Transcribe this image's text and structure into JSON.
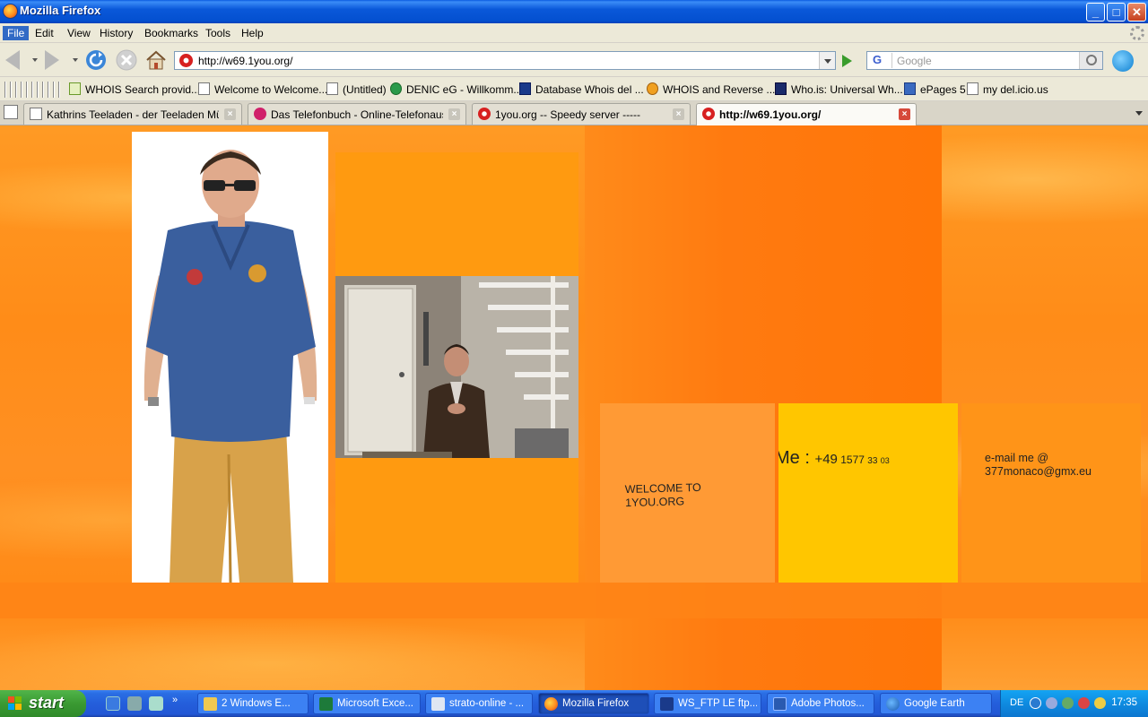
{
  "window": {
    "title": "Mozilla Firefox",
    "controls": {
      "minimize": "_",
      "maximize": "□",
      "close": "✕"
    }
  },
  "menu": [
    {
      "label": "File",
      "active": true
    },
    {
      "label": "Edit"
    },
    {
      "label": "View"
    },
    {
      "label": "History"
    },
    {
      "label": "Bookmarks"
    },
    {
      "label": "Tools"
    },
    {
      "label": "Help"
    }
  ],
  "navigation": {
    "url": "http://w69.1you.org/",
    "search_placeholder": "Google",
    "search_engine_glyph": "G"
  },
  "bookmarks": [
    {
      "label": "WHOIS Search provid...",
      "icon": "n-icon"
    },
    {
      "label": "Welcome to Welcome...",
      "icon": "page-icon"
    },
    {
      "label": "(Untitled)",
      "icon": "page-icon"
    },
    {
      "label": "DENIC eG - Willkomm...",
      "icon": "denic-icon"
    },
    {
      "label": "Database Whois del ...",
      "icon": "database-icon"
    },
    {
      "label": "WHOIS and Reverse ...",
      "icon": "whois-icon"
    },
    {
      "label": "Who.is: Universal Wh...",
      "icon": "whois-square-icon"
    },
    {
      "label": "ePages 5",
      "icon": "epages-icon"
    },
    {
      "label": "my del.icio.us",
      "icon": "page-icon"
    }
  ],
  "tabs": [
    {
      "label": "Kathrins Teeladen - der Teeladen Mün...",
      "active": false,
      "icon": "page-icon"
    },
    {
      "label": "Das Telefonbuch - Online-Telefonausk...",
      "active": false,
      "icon": "telefonbuch-icon"
    },
    {
      "label": "1you.org -- Speedy server -----",
      "active": false,
      "icon": "gear-red-icon"
    },
    {
      "label": "http://w69.1you.org/",
      "active": true,
      "icon": "gear-red-icon"
    }
  ],
  "page": {
    "welcome_line1": "Welcome to",
    "welcome_line2": "1YOU.ORG",
    "phone_prefix": "Me : ",
    "phone_country": "+49",
    "phone_number": "1577",
    "phone_part2": "33",
    "phone_part3": "03",
    "email_label": "e-mail me @",
    "email_address": "377monaco@gmx.eu",
    "colors": {
      "background": "#ff8c18",
      "welcome_tile": "#ff9a35",
      "phone_tile": "#ffc600",
      "email_tile": "#ff9418",
      "orange_block": "#ff9a10"
    }
  },
  "taskbar": {
    "start_label": "start",
    "tasks": [
      {
        "label": "2 Windows E...",
        "icon": "folder-icon",
        "active": false
      },
      {
        "label": "Microsoft Exce...",
        "icon": "excel-icon",
        "active": false
      },
      {
        "label": "strato-online - ...",
        "icon": "outlook-icon",
        "active": false
      },
      {
        "label": "Mozilla Firefox",
        "icon": "firefox-icon",
        "active": true
      },
      {
        "label": "WS_FTP LE ftp....",
        "icon": "ftp-icon",
        "active": false
      },
      {
        "label": "Adobe Photos...",
        "icon": "photoshop-icon",
        "active": false
      },
      {
        "label": "Google Earth",
        "icon": "google-earth-icon",
        "active": false
      }
    ],
    "tray": {
      "language": "DE",
      "clock": "17:35"
    }
  }
}
